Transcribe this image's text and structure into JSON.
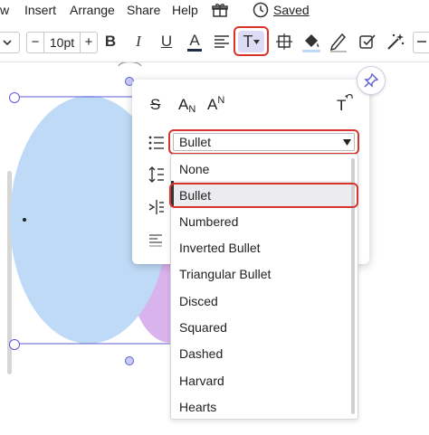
{
  "menubar": {
    "items": [
      "w",
      "Insert",
      "Arrange",
      "Share",
      "Help"
    ],
    "status": "Saved"
  },
  "toolbar": {
    "font_size": "10pt",
    "decrease_label": "−",
    "increase_label": "+",
    "bold": "B",
    "italic": "I",
    "underline": "U",
    "text_color": "A",
    "text_options": "T"
  },
  "panel": {
    "strikethrough": "S",
    "subscript_base": "A",
    "subscript_mark": "N",
    "superscript_base": "A",
    "superscript_mark": "N",
    "clear_format": "T",
    "bullet_select_value": "Bullet"
  },
  "bullet_options": [
    "None",
    "Bullet",
    "Numbered",
    "Inverted Bullet",
    "Triangular Bullet",
    "Disced",
    "Squared",
    "Dashed",
    "Harvard",
    "Hearts"
  ],
  "selected_option": "Bullet",
  "colors": {
    "highlight_red": "#d9342b",
    "shape_blue": "#bfdaf7",
    "shape_purple": "#d9b3ec",
    "selection_line": "#5b5bd6",
    "active_button_bg": "#dcdcf7"
  }
}
